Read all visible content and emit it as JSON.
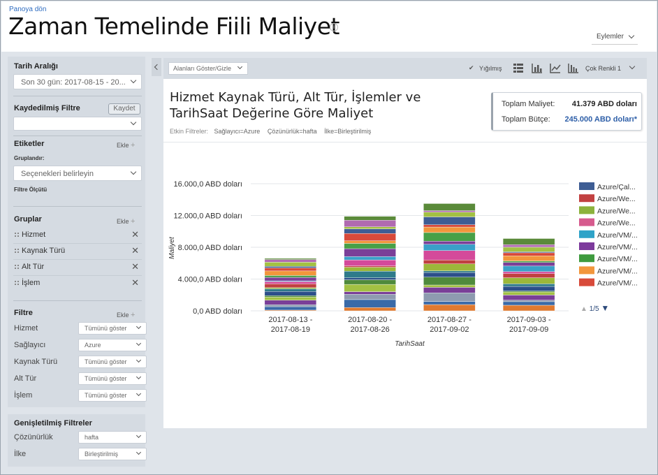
{
  "header": {
    "back_link": "Panoya dön",
    "title": "Zaman Temelinde Fiili Maliyet",
    "actions_label": "Eylemler"
  },
  "sidebar": {
    "date_range": {
      "title": "Tarih Aralığı",
      "value": "Son 30 gün: 2017-08-15 - 20..."
    },
    "saved_filter": {
      "title": "Kaydedilmiş Filtre",
      "save_label": "Kaydet",
      "value": ""
    },
    "tags": {
      "title": "Etiketler",
      "add_label": "Ekle",
      "group_by_label": "Gruplandır:",
      "group_by_placeholder": "Seçenekleri belirleyin",
      "filter_by_label": "Filtre Ölçütü"
    },
    "groups": {
      "title": "Gruplar",
      "add_label": "Ekle",
      "items": [
        "Hizmet",
        "Kaynak Türü",
        "Alt Tür",
        "İşlem"
      ]
    },
    "filter": {
      "title": "Filtre",
      "add_label": "Ekle",
      "items": [
        {
          "label": "Hizmet",
          "value": "Tümünü göster"
        },
        {
          "label": "Sağlayıcı",
          "value": "Azure"
        },
        {
          "label": "Kaynak Türü",
          "value": "Tümünü göster"
        },
        {
          "label": "Alt Tür",
          "value": "Tümünü göster"
        },
        {
          "label": "İşlem",
          "value": "Tümünü göster"
        }
      ]
    },
    "extended": {
      "title": "Genişletilmiş Filtreler",
      "items": [
        {
          "label": "Çözünürlük",
          "value": "hafta"
        },
        {
          "label": "İlke",
          "value": "Birleştirilmiş"
        }
      ]
    }
  },
  "toolbar": {
    "fields_button": "Alanları Göster/Gizle",
    "stacked_label": "Yığılmış",
    "stacked_checked": true,
    "color_label": "Çok Renkli 1",
    "icons": [
      "table-view-icon",
      "bar-chart-icon",
      "line-chart-icon",
      "column-chart-icon"
    ]
  },
  "report": {
    "title": "Hizmet Kaynak Türü, Alt Tür, İşlemler ve TarihSaat Değerine Göre Maliyet",
    "active_filters_label": "Etkin Filtreler:",
    "active_filters": [
      "Sağlayıcı=Azure",
      "Çözünürlük=hafta",
      "İlke=Birleştirilmiş"
    ],
    "total_cost_label": "Toplam Maliyet:",
    "total_cost_value": "41.379 ABD doları",
    "total_budget_label": "Toplam Bütçe:",
    "total_budget_value": "245.000 ABD doları*"
  },
  "chart_data": {
    "type": "bar",
    "stacked": true,
    "xlabel": "TarihSaat",
    "ylabel": "Maliyet",
    "ylim": [
      0,
      16000
    ],
    "y_ticks": [
      "0,0 ABD doları",
      "4.000,0 ABD doları",
      "8.000,0 ABD doları",
      "12.000,0 ABD doları",
      "16.000,0 ABD doları"
    ],
    "categories": [
      "2017-08-13 - 2017-08-19",
      "2017-08-20 - 2017-08-26",
      "2017-08-27 - 2017-09-02",
      "2017-09-03 - 2017-09-09"
    ],
    "totals": [
      6600,
      11900,
      13500,
      9100
    ],
    "segment_colors": [
      "#e07a30",
      "#3a6aa8",
      "#8e9bb0",
      "#7a3f98",
      "#a3c143",
      "#4f8a3c",
      "#2c4f8a",
      "#2f7b8a",
      "#9cb83a",
      "#c04040",
      "#d44a9a",
      "#3aa0c8",
      "#7a3f98",
      "#47a047",
      "#f2963c",
      "#d84a3a",
      "#3e5d94",
      "#a3c143",
      "#b06bb0",
      "#5a8a3a"
    ],
    "legend": [
      {
        "name": "Azure/Çal...",
        "color": "#3e5d94"
      },
      {
        "name": "Azure/We...",
        "color": "#c24141"
      },
      {
        "name": "Azure/We...",
        "color": "#8cb23c"
      },
      {
        "name": "Azure/We...",
        "color": "#d65b8e"
      },
      {
        "name": "Azure/VM/...",
        "color": "#2fa3c8"
      },
      {
        "name": "Azure/VM/...",
        "color": "#7d3a9c"
      },
      {
        "name": "Azure/VM/...",
        "color": "#3e9a3e"
      },
      {
        "name": "Azure/VM/...",
        "color": "#f2963c"
      },
      {
        "name": "Azure/VM/...",
        "color": "#d84a3a"
      }
    ],
    "legend_page": "1/5"
  }
}
